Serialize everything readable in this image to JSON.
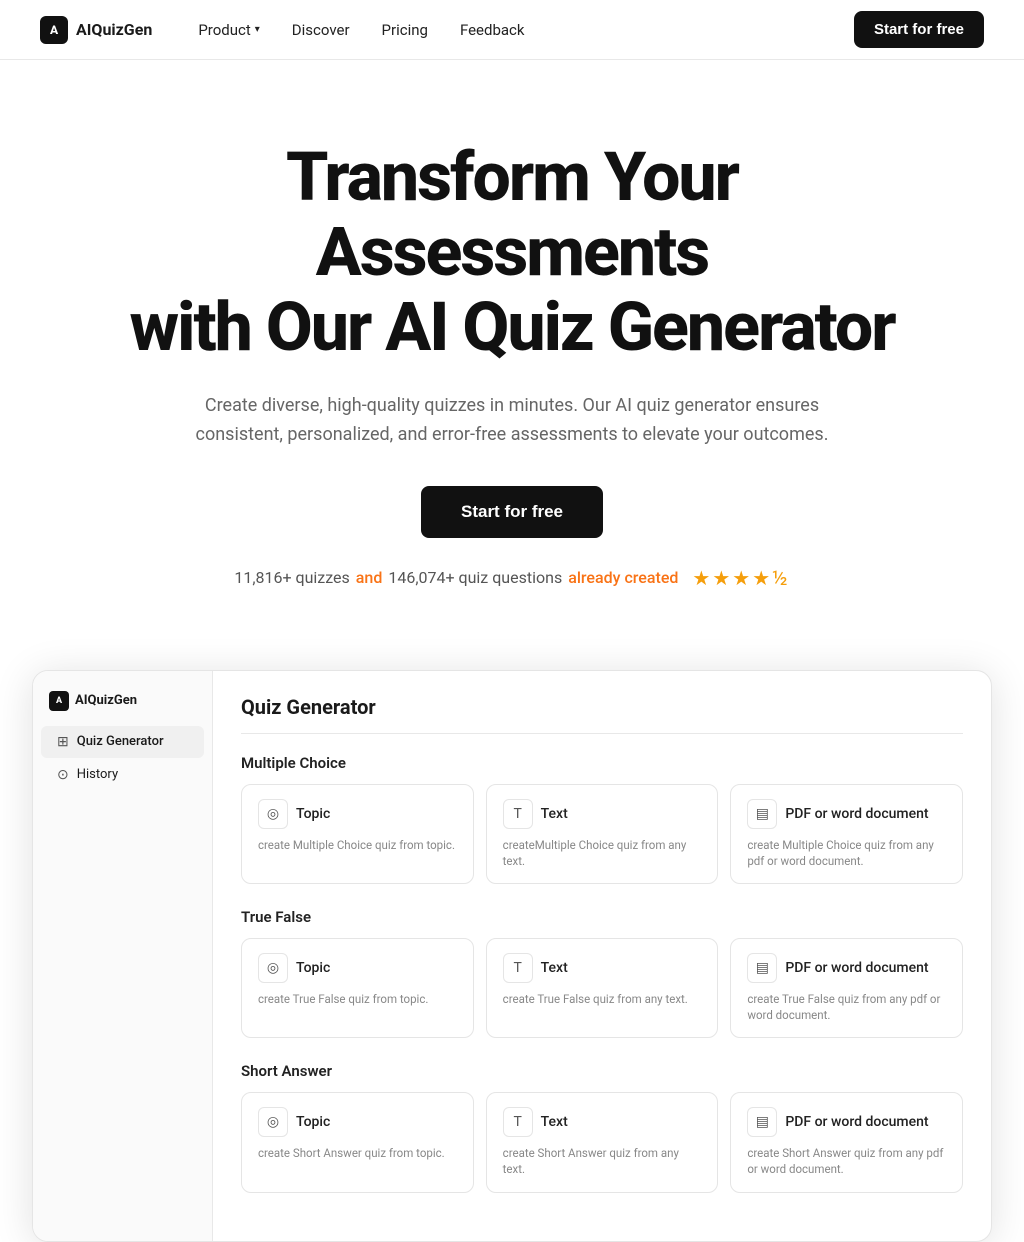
{
  "brand": {
    "name": "AIQuizGen",
    "logo_text": "A"
  },
  "nav": {
    "links": [
      {
        "id": "product",
        "label": "Product",
        "has_dropdown": true
      },
      {
        "id": "discover",
        "label": "Discover",
        "has_dropdown": false
      },
      {
        "id": "pricing",
        "label": "Pricing",
        "has_dropdown": false
      },
      {
        "id": "feedback",
        "label": "Feedback",
        "has_dropdown": false
      }
    ],
    "cta_label": "Start for free"
  },
  "hero": {
    "headline_line1": "Transform Your Assessments",
    "headline_line2": "with Our AI Quiz Generator",
    "subtext": "Create diverse, high-quality quizzes in minutes. Our AI quiz generator ensures consistent, personalized, and error-free assessments to elevate your outcomes.",
    "cta_label": "Start for free",
    "stats_prefix": "11,816+ quizzes",
    "stats_and": "and",
    "stats_middle": "146,074+ quiz questions",
    "stats_suffix": "already created",
    "stars": "★★★★½"
  },
  "app_preview": {
    "sidebar": {
      "brand": "AIQuizGen",
      "items": [
        {
          "id": "quiz-generator",
          "label": "Quiz Generator",
          "icon": "⊞",
          "active": true
        },
        {
          "id": "history",
          "label": "History",
          "icon": "⊙",
          "active": false
        }
      ]
    },
    "main": {
      "title": "Quiz Generator",
      "sections": [
        {
          "id": "multiple-choice",
          "label": "Multiple Choice",
          "cards": [
            {
              "id": "mc-topic",
              "icon": "◎",
              "title": "Topic",
              "desc": "create Multiple Choice quiz from topic."
            },
            {
              "id": "mc-text",
              "icon": "T",
              "title": "Text",
              "desc": "createMultiple Choice quiz from any text."
            },
            {
              "id": "mc-pdf",
              "icon": "▤",
              "title": "PDF or word document",
              "desc": "create Multiple Choice quiz from any pdf or word document."
            }
          ]
        },
        {
          "id": "true-false",
          "label": "True False",
          "cards": [
            {
              "id": "tf-topic",
              "icon": "◎",
              "title": "Topic",
              "desc": "create True False quiz from topic."
            },
            {
              "id": "tf-text",
              "icon": "T",
              "title": "Text",
              "desc": "create True False quiz from any text."
            },
            {
              "id": "tf-pdf",
              "icon": "▤",
              "title": "PDF or word document",
              "desc": "create True False quiz from any pdf or word document."
            }
          ]
        },
        {
          "id": "short-answer",
          "label": "Short Answer",
          "cards": [
            {
              "id": "sa-topic",
              "icon": "◎",
              "title": "Topic",
              "desc": "create Short Answer quiz from topic."
            },
            {
              "id": "sa-text",
              "icon": "T",
              "title": "Text",
              "desc": "create Short Answer quiz from any text."
            },
            {
              "id": "sa-pdf",
              "icon": "▤",
              "title": "PDF or word document",
              "desc": "create Short Answer quiz from any pdf or word document."
            }
          ]
        }
      ]
    }
  }
}
